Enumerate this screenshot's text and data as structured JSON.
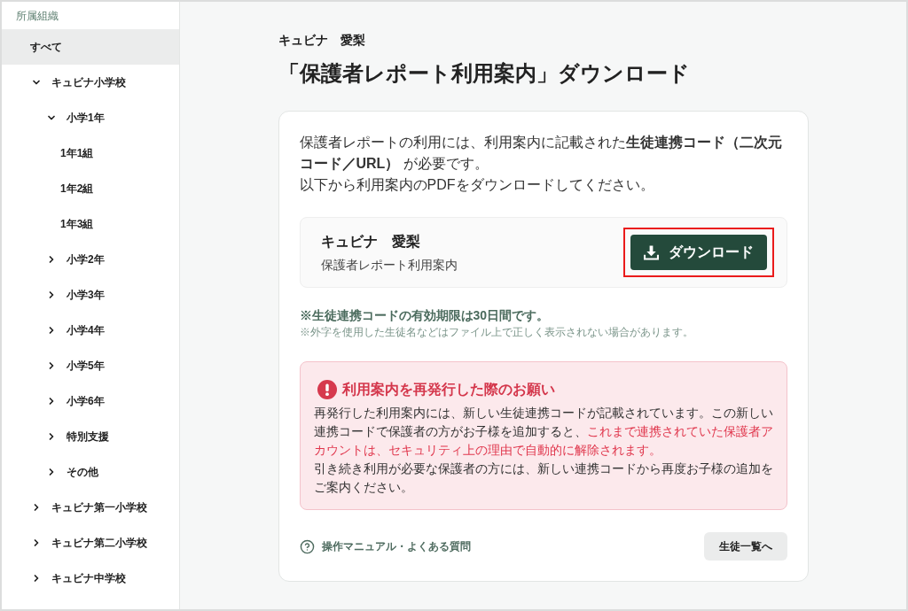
{
  "sidebar": {
    "heading": "所属組織",
    "items": [
      {
        "label": "すべて",
        "selected": true
      },
      {
        "label": "キュビナ小学校",
        "selected": false,
        "expanded": true,
        "children": [
          {
            "label": "小学1年",
            "selected": false,
            "expanded": true,
            "children": [
              {
                "label": "1年1組",
                "selected": false
              },
              {
                "label": "1年2組",
                "selected": false
              },
              {
                "label": "1年3組",
                "selected": false
              }
            ]
          },
          {
            "label": "小学2年",
            "selected": false,
            "expanded": false
          },
          {
            "label": "小学3年",
            "selected": false,
            "expanded": false
          },
          {
            "label": "小学4年",
            "selected": false,
            "expanded": false
          },
          {
            "label": "小学5年",
            "selected": false,
            "expanded": false
          },
          {
            "label": "小学6年",
            "selected": false,
            "expanded": false
          },
          {
            "label": "特別支援",
            "selected": false,
            "expanded": false
          },
          {
            "label": "その他",
            "selected": false,
            "expanded": false
          }
        ]
      },
      {
        "label": "キュビナ第一小学校",
        "selected": false,
        "expanded": false
      },
      {
        "label": "キュビナ第二小学校",
        "selected": false,
        "expanded": false
      },
      {
        "label": "キュビナ中学校",
        "selected": false,
        "expanded": false
      }
    ]
  },
  "student_name": "キュビナ　愛梨",
  "page_title": "「保護者レポート利用案内」ダウンロード",
  "card": {
    "intro": [
      "保護者レポートの利用には、利用案内に記載された**生徒連携コード（二次元コード／URL）** が必要です。",
      "以下から利用案内のPDFをダウンロードしてください。"
    ],
    "download_item": {
      "name": "キュビナ　愛梨",
      "description": "保護者レポート利用案内",
      "button": "ダウンロード",
      "highlighted": true
    },
    "notes": [
      {
        "kind": "emphasis",
        "text": "※生徒連携コードの有効期限は30日間です。"
      },
      {
        "kind": "small",
        "text": "※外字を使用した生徒名などはファイル上で正しく表示されない場合があります。"
      }
    ],
    "alert": {
      "title": "利用案内を再発行した際のお願い",
      "paragraphs": [
        {
          "segments": [
            {
              "text": "再発行した利用案内には、新しい生徒連携コードが記載されています。この新しい連携コードで保護者の方がお子様を追加すると、",
              "warning": false
            },
            {
              "text": "これまで連携されていた保護者アカウントは、セキュリティ上の理由で自動的に解除されます。",
              "warning": true
            }
          ]
        },
        {
          "segments": [
            {
              "text": "引き続き利用が必要な保護者の方には、新しい連携コードから再度お子様の追加をご案内ください。",
              "warning": false
            }
          ]
        }
      ]
    },
    "help_link": "操作マニュアル・よくある質問",
    "back_button": "生徒一覧へ"
  }
}
